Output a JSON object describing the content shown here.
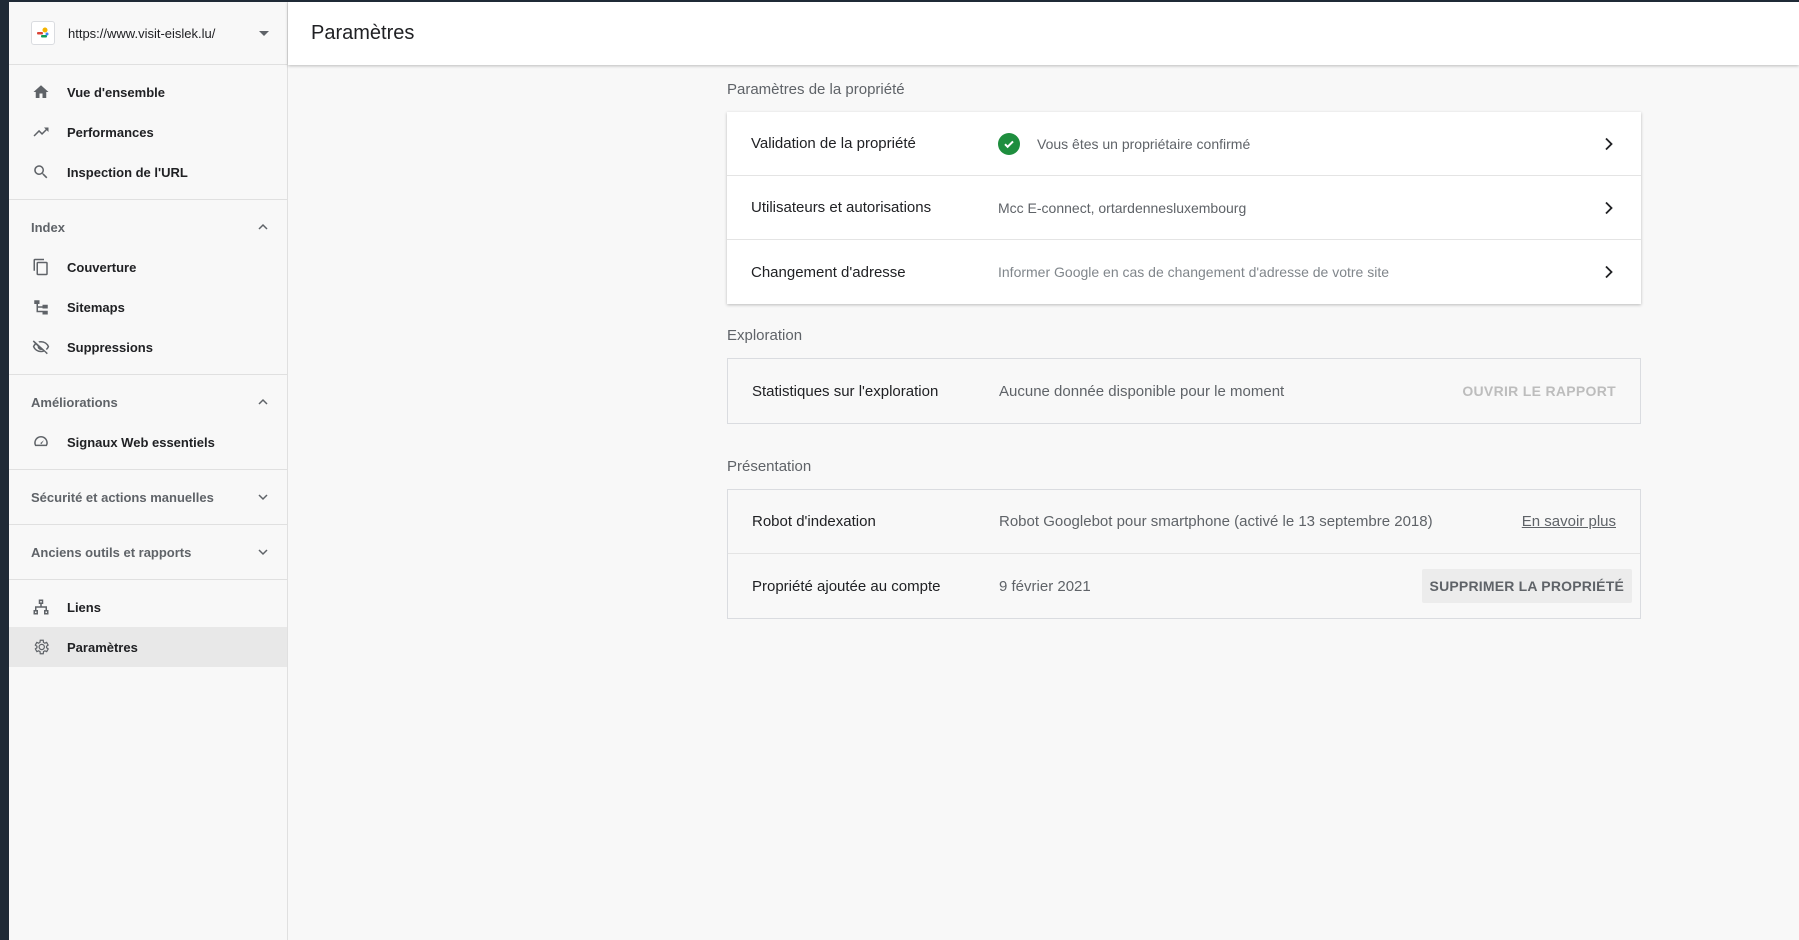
{
  "property": {
    "url": "https://www.visit-eislek.lu/"
  },
  "header": {
    "title": "Paramètres"
  },
  "sidebar": {
    "top_items": [
      {
        "label": "Vue d'ensemble",
        "icon": "home-icon"
      },
      {
        "label": "Performances",
        "icon": "trending-up-icon"
      },
      {
        "label": "Inspection de l'URL",
        "icon": "search-icon"
      }
    ],
    "index": {
      "title": "Index",
      "items": [
        {
          "label": "Couverture",
          "icon": "copy-icon"
        },
        {
          "label": "Sitemaps",
          "icon": "sitemap-icon"
        },
        {
          "label": "Suppressions",
          "icon": "eye-off-icon"
        }
      ]
    },
    "ameliorations": {
      "title": "Améliorations",
      "items": [
        {
          "label": "Signaux Web essentiels",
          "icon": "speed-gauge-icon"
        }
      ]
    },
    "securite": {
      "title": "Sécurité et actions manuelles"
    },
    "anciens": {
      "title": "Anciens outils et rapports"
    },
    "bottom_items": [
      {
        "label": "Liens",
        "icon": "links-icon"
      },
      {
        "label": "Paramètres",
        "icon": "gear-icon",
        "active": true
      }
    ]
  },
  "property_settings": {
    "title": "Paramètres de la propriété",
    "rows": [
      {
        "title": "Validation de la propriété",
        "value": "Vous êtes un propriétaire confirmé"
      },
      {
        "title": "Utilisateurs et autorisations",
        "value": "Mcc E-connect, ortardennesluxembourg"
      },
      {
        "title": "Changement d'adresse",
        "value": "Informer Google en cas de changement d'adresse de votre site"
      }
    ]
  },
  "exploration": {
    "title": "Exploration",
    "row": {
      "title": "Statistiques sur l'exploration",
      "value": "Aucune donnée disponible pour le moment",
      "action": "OUVRIR LE RAPPORT"
    }
  },
  "presentation": {
    "title": "Présentation",
    "rows": [
      {
        "title": "Robot d'indexation",
        "value": "Robot Googlebot pour smartphone (activé le 13 septembre 2018)",
        "action": "En savoir plus"
      },
      {
        "title": "Propriété ajoutée au compte",
        "value": "9 février 2021",
        "action": "SUPPRIMER LA PROPRIÉTÉ"
      }
    ]
  },
  "colors": {
    "accent_green": "#1e8e3e",
    "sidebar_bg": "#f8f8f8",
    "active_bg": "#e8e8e8"
  }
}
